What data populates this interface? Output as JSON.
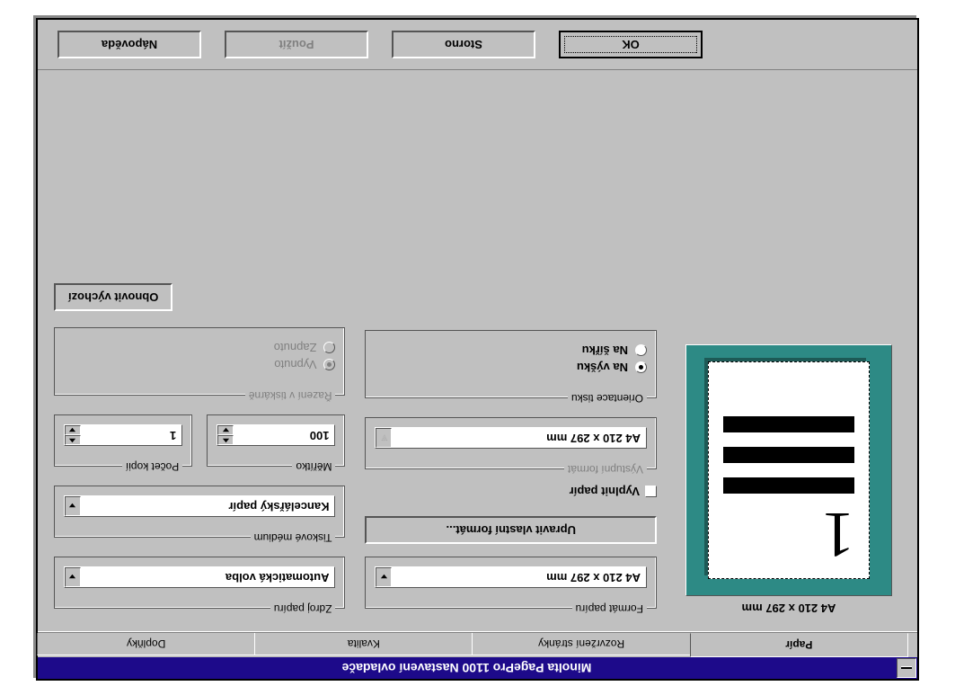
{
  "window_title": "Minolta PagePro 1100 Nastavení ovladače",
  "tabs": {
    "papir": "Papír",
    "rozvrzeni": "Rozvržení stránky",
    "kvalita": "Kvalita",
    "doplnky": "Doplňky"
  },
  "preview": {
    "label": "A4 210 x 297 mm",
    "page_number": "1"
  },
  "format_papiru": {
    "legend": "Formát papíru",
    "value": "A4 210 x 297 mm"
  },
  "upravit_btn": "Upravit vlastní formát...",
  "vyplnit": "Vyplnit papír",
  "vystupni": {
    "legend": "Výstupní formát",
    "value": "A4 210 x 297 mm"
  },
  "orientace": {
    "legend": "Orientace tisku",
    "vyska": "Na výšku",
    "sirka": "Na šířku"
  },
  "zdroj": {
    "legend": "Zdroj papíru",
    "value": "Automatická volba"
  },
  "medium": {
    "legend": "Tiskové médium",
    "value": "Kancelářský papír"
  },
  "meritko": {
    "legend": "Měřítko",
    "value": "100"
  },
  "kopie": {
    "legend": "Počet kopií",
    "value": "1"
  },
  "razeni": {
    "legend": "Řazení v tiskárně",
    "vypnuto": "Vypnuto",
    "zapnuto": "Zapnuto"
  },
  "obnovit": "Obnovit výchozí",
  "buttons": {
    "ok": "OK",
    "storno": "Storno",
    "pouzit": "Použít",
    "napoveda": "Nápověda"
  }
}
